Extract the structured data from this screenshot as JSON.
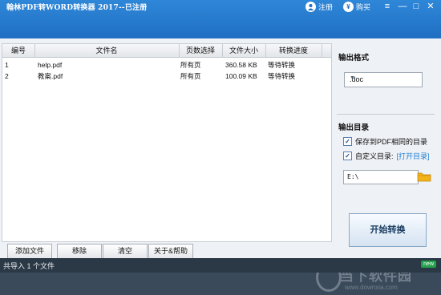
{
  "window": {
    "title": "翰林PDF转WORD转换器 2017--已注册",
    "register_label": "注册",
    "buy_label": "购买",
    "controls": [
      "≡",
      "—",
      "□",
      "✕"
    ]
  },
  "table": {
    "columns": [
      "编号",
      "文件名",
      "页数选择",
      "文件大小",
      "转换进度"
    ],
    "rows": [
      {
        "num": "1",
        "name": "help.pdf",
        "pages": "所有页",
        "size": "360.58 KB",
        "progress": "等待转换"
      },
      {
        "num": "2",
        "name": "教案.pdf",
        "pages": "所有页",
        "size": "100.09 KB",
        "progress": "等待转换"
      }
    ]
  },
  "buttons": {
    "add": "添加文件",
    "remove": "移除",
    "clear": "清空",
    "about": "关于&帮助"
  },
  "panel": {
    "format_title": "输出格式",
    "format_value": ".doc",
    "dir_title": "输出目录",
    "same_dir_label": "保存到PDF相同的目录",
    "custom_dir_label": "自定义目录:",
    "open_dir_link": "[打开目录]",
    "path_value": "E:\\",
    "start_label": "开始转换"
  },
  "status": {
    "text": "共导入 1 个文件",
    "badge": "new"
  },
  "watermark": {
    "name": "当下软件园",
    "url": "www.downxia.com"
  },
  "colors": {
    "titlebar": "#1f6fc3",
    "link": "#1e7fd8",
    "status": "#2b3846"
  }
}
